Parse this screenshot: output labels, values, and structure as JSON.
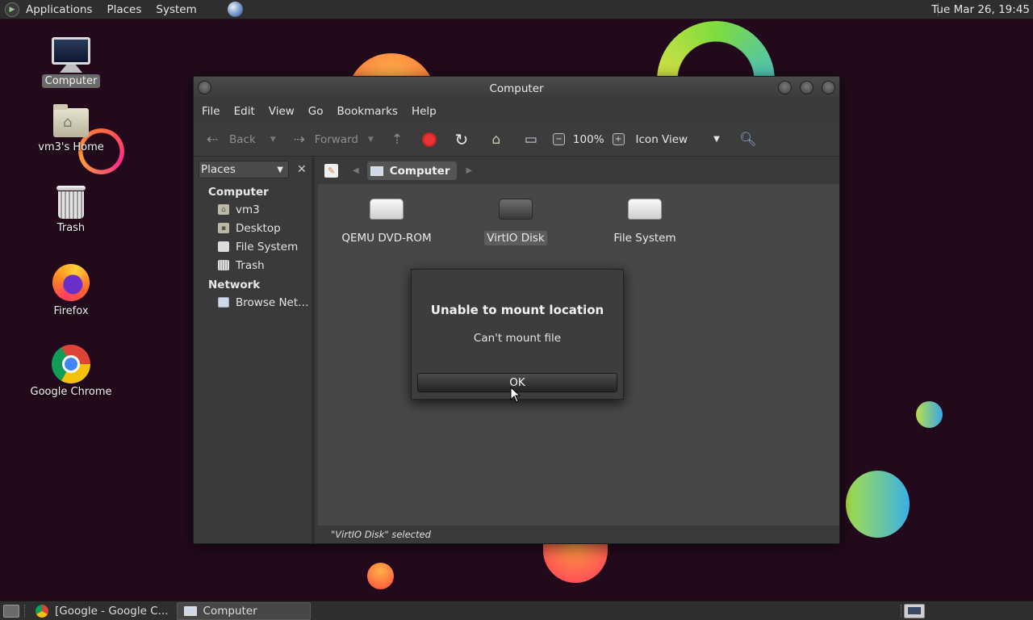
{
  "top_panel": {
    "menus": [
      "Applications",
      "Places",
      "System"
    ],
    "clock": "Tue Mar 26, 19:45"
  },
  "desktop_icons": [
    {
      "label": "Computer",
      "icon": "computer-icon",
      "selected": true
    },
    {
      "label": "vm3's Home",
      "icon": "home-folder-icon",
      "selected": false
    },
    {
      "label": "Trash",
      "icon": "trash-icon",
      "selected": false
    },
    {
      "label": "Firefox",
      "icon": "firefox-icon",
      "selected": false
    },
    {
      "label": "Google Chrome",
      "icon": "chrome-icon",
      "selected": false
    }
  ],
  "window": {
    "title": "Computer",
    "menu": [
      "File",
      "Edit",
      "View",
      "Go",
      "Bookmarks",
      "Help"
    ],
    "toolbar": {
      "back": "Back",
      "forward": "Forward",
      "zoom": "100%",
      "view_mode": "Icon View"
    },
    "sidebar": {
      "selector": "Places",
      "sections": [
        {
          "title": "Computer",
          "items": [
            "vm3",
            "Desktop",
            "File System",
            "Trash"
          ]
        },
        {
          "title": "Network",
          "items": [
            "Browse Net…"
          ]
        }
      ]
    },
    "path": {
      "current": "Computer"
    },
    "items": [
      {
        "label": "QEMU DVD-ROM",
        "icon": "optical-drive-icon",
        "selected": false
      },
      {
        "label": "VirtIO Disk",
        "icon": "hard-disk-icon",
        "selected": true
      },
      {
        "label": "File System",
        "icon": "filesystem-drive-icon",
        "selected": false
      }
    ],
    "status": "\"VirtIO Disk\" selected"
  },
  "dialog": {
    "title": "Unable to mount location",
    "message": "Can't mount file",
    "ok_label": "OK"
  },
  "taskbar": {
    "tasks": [
      {
        "label": "[Google - Google C...",
        "active": false
      },
      {
        "label": "Computer",
        "active": true
      }
    ]
  }
}
